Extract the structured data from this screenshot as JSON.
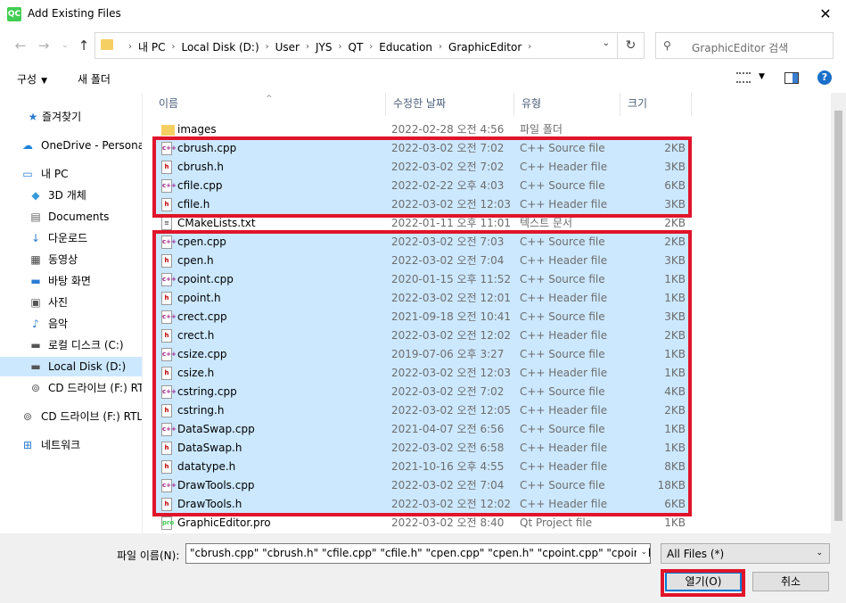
{
  "window": {
    "title": "Add Existing Files",
    "app_icon_text": "QC"
  },
  "address": {
    "crumbs": [
      "내 PC",
      "Local Disk (D:)",
      "User",
      "JYS",
      "QT",
      "Education",
      "GraphicEditor"
    ]
  },
  "search": {
    "placeholder": "GraphicEditor 검색"
  },
  "toolbar": {
    "organize": "구성",
    "new_folder": "새 폴더"
  },
  "sidebar": {
    "items": [
      {
        "label": "즐겨찾기",
        "icon": "star-icon"
      },
      {
        "label": "OneDrive - Personal",
        "icon": "cloud-icon"
      },
      {
        "label": "내 PC",
        "icon": "pc-icon"
      },
      {
        "label": "3D 개체",
        "icon": "cube-icon"
      },
      {
        "label": "Documents",
        "icon": "document-icon"
      },
      {
        "label": "다운로드",
        "icon": "download-icon"
      },
      {
        "label": "동영상",
        "icon": "video-icon"
      },
      {
        "label": "바탕 화면",
        "icon": "desktop-icon"
      },
      {
        "label": "사진",
        "icon": "picture-icon"
      },
      {
        "label": "음악",
        "icon": "music-icon"
      },
      {
        "label": "로컬 디스크 (C:)",
        "icon": "drive-icon"
      },
      {
        "label": "Local Disk (D:)",
        "icon": "drive-icon"
      },
      {
        "label": "CD 드라이브 (F:) RTL",
        "icon": "cd-drive-icon"
      },
      {
        "label": "CD 드라이브 (F:) RTL",
        "icon": "cd-drive-icon"
      },
      {
        "label": "네트워크",
        "icon": "network-icon"
      }
    ]
  },
  "columns": {
    "name": "이름",
    "date": "수정한 날짜",
    "type": "유형",
    "size": "크기"
  },
  "files": [
    {
      "name": "images",
      "date": "2022-02-28 오전 4:56",
      "type": "파일 폴더",
      "size": "",
      "kind": "folder",
      "selected": false
    },
    {
      "name": "cbrush.cpp",
      "date": "2022-03-02 오전 7:02",
      "type": "C++ Source file",
      "size": "2KB",
      "kind": "cpp",
      "selected": true
    },
    {
      "name": "cbrush.h",
      "date": "2022-03-02 오전 7:02",
      "type": "C++ Header file",
      "size": "3KB",
      "kind": "h",
      "selected": true
    },
    {
      "name": "cfile.cpp",
      "date": "2022-02-22 오후 4:03",
      "type": "C++ Source file",
      "size": "6KB",
      "kind": "cpp",
      "selected": true
    },
    {
      "name": "cfile.h",
      "date": "2022-03-02 오전 12:03",
      "type": "C++ Header file",
      "size": "3KB",
      "kind": "h",
      "selected": true
    },
    {
      "name": "CMakeLists.txt",
      "date": "2022-01-11 오후 11:01",
      "type": "텍스트 문서",
      "size": "2KB",
      "kind": "txt",
      "selected": false
    },
    {
      "name": "cpen.cpp",
      "date": "2022-03-02 오전 7:03",
      "type": "C++ Source file",
      "size": "2KB",
      "kind": "cpp",
      "selected": true
    },
    {
      "name": "cpen.h",
      "date": "2022-03-02 오전 7:04",
      "type": "C++ Header file",
      "size": "3KB",
      "kind": "h",
      "selected": true
    },
    {
      "name": "cpoint.cpp",
      "date": "2020-01-15 오후 11:52",
      "type": "C++ Source file",
      "size": "1KB",
      "kind": "cpp",
      "selected": true
    },
    {
      "name": "cpoint.h",
      "date": "2022-03-02 오전 12:01",
      "type": "C++ Header file",
      "size": "1KB",
      "kind": "h",
      "selected": true
    },
    {
      "name": "crect.cpp",
      "date": "2021-09-18 오전 10:41",
      "type": "C++ Source file",
      "size": "3KB",
      "kind": "cpp",
      "selected": true
    },
    {
      "name": "crect.h",
      "date": "2022-03-02 오전 12:02",
      "type": "C++ Header file",
      "size": "2KB",
      "kind": "h",
      "selected": true
    },
    {
      "name": "csize.cpp",
      "date": "2019-07-06 오후 3:27",
      "type": "C++ Source file",
      "size": "1KB",
      "kind": "cpp",
      "selected": true
    },
    {
      "name": "csize.h",
      "date": "2022-03-02 오전 12:03",
      "type": "C++ Header file",
      "size": "1KB",
      "kind": "h",
      "selected": true
    },
    {
      "name": "cstring.cpp",
      "date": "2022-03-02 오전 7:02",
      "type": "C++ Source file",
      "size": "4KB",
      "kind": "cpp",
      "selected": true
    },
    {
      "name": "cstring.h",
      "date": "2022-03-02 오전 12:05",
      "type": "C++ Header file",
      "size": "2KB",
      "kind": "h",
      "selected": true
    },
    {
      "name": "DataSwap.cpp",
      "date": "2021-04-07 오전 6:56",
      "type": "C++ Source file",
      "size": "1KB",
      "kind": "cpp",
      "selected": true
    },
    {
      "name": "DataSwap.h",
      "date": "2022-03-02 오전 6:58",
      "type": "C++ Header file",
      "size": "1KB",
      "kind": "h",
      "selected": true
    },
    {
      "name": "datatype.h",
      "date": "2021-10-16 오후 4:55",
      "type": "C++ Header file",
      "size": "8KB",
      "kind": "h",
      "selected": true
    },
    {
      "name": "DrawTools.cpp",
      "date": "2022-03-02 오전 7:04",
      "type": "C++ Source file",
      "size": "18KB",
      "kind": "cpp",
      "selected": true
    },
    {
      "name": "DrawTools.h",
      "date": "2022-03-02 오전 12:02",
      "type": "C++ Header file",
      "size": "6KB",
      "kind": "h",
      "selected": true
    },
    {
      "name": "GraphicEditor.pro",
      "date": "2022-03-02 오전 8:40",
      "type": "Qt Project file",
      "size": "1KB",
      "kind": "pro",
      "selected": false
    }
  ],
  "bottom": {
    "filename_label": "파일 이름(N):",
    "filename_value": "\"cbrush.cpp\" \"cbrush.h\" \"cfile.cpp\" \"cfile.h\" \"cpen.cpp\" \"cpen.h\" \"cpoint.cpp\" \"cpoint.h\" \"crect",
    "filter_value": "All Files (*)",
    "open_label": "열기(O)",
    "cancel_label": "취소"
  },
  "colors": {
    "selection": "#cce8ff",
    "highlight_box": "#e0142a",
    "accent": "#0078d7"
  }
}
